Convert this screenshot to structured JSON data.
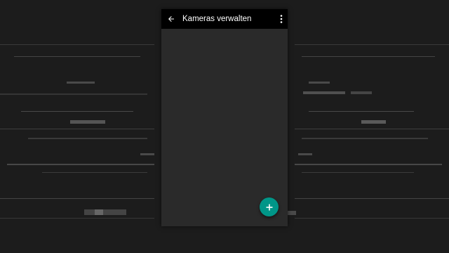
{
  "appbar": {
    "title": "Kameras verwalten",
    "back_icon": "arrow-back-icon",
    "menu_icon": "more-vert-icon"
  },
  "fab": {
    "icon": "plus-icon"
  },
  "colors": {
    "background": "#1e1e1e",
    "panel": "#2a2a2a",
    "appbar": "#000000",
    "accent": "#009688"
  }
}
